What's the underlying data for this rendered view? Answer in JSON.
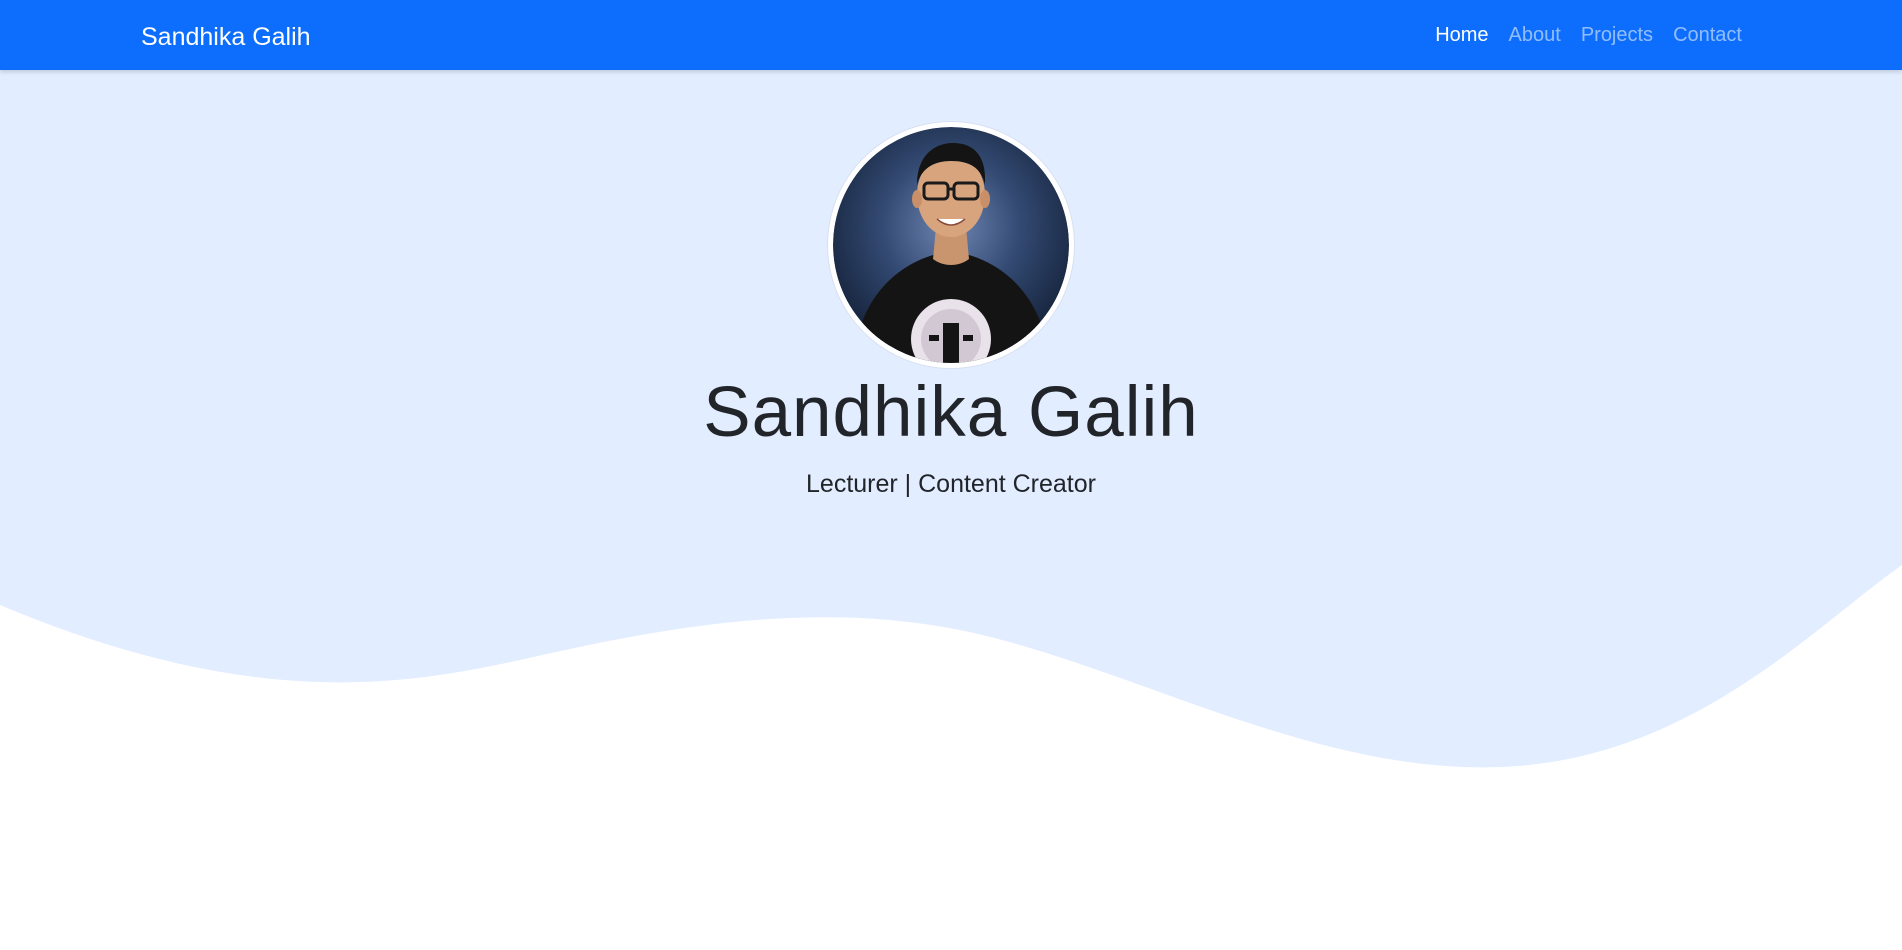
{
  "colors": {
    "navbar_bg": "#0d6efd",
    "hero_bg": "#e2edff",
    "text": "#212529"
  },
  "navbar": {
    "brand": "Sandhika Galih",
    "links": [
      {
        "label": "Home",
        "active": true
      },
      {
        "label": "About",
        "active": false
      },
      {
        "label": "Projects",
        "active": false
      },
      {
        "label": "Contact",
        "active": false
      }
    ]
  },
  "hero": {
    "title": "Sandhika Galih",
    "subtitle": "Lecturer | Content Creator",
    "avatar_icon": "profile-photo"
  }
}
